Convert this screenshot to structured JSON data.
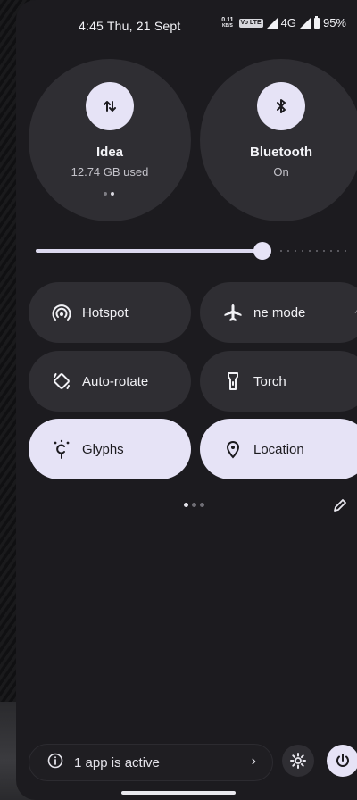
{
  "status_bar": {
    "time_date": "4:45  Thu, 21 Sept",
    "net_speed_value": "0.11",
    "net_speed_unit": "KB/S",
    "volte": "Vo LTE",
    "network": "4G",
    "battery": "95%"
  },
  "large_tiles": [
    {
      "title": "Idea",
      "subtitle": "12.74 GB used",
      "icon": "mobile-data-icon"
    },
    {
      "title": "Bluetooth",
      "subtitle": "On",
      "icon": "bluetooth-icon"
    }
  ],
  "brightness": {
    "level": 0.68
  },
  "tiles": [
    {
      "label": "Hotspot",
      "icon": "hotspot-icon",
      "active": false
    },
    {
      "label": "ne mode",
      "icon": "airplane-icon",
      "active": false
    },
    {
      "label": "Auto-rotate",
      "icon": "auto-rotate-icon",
      "active": false
    },
    {
      "label": "Torch",
      "icon": "torch-icon",
      "active": false
    },
    {
      "label": "Glyphs",
      "icon": "glyphs-icon",
      "active": true
    },
    {
      "label": "Location",
      "icon": "location-icon",
      "active": true
    }
  ],
  "footer": {
    "active_apps": "1 app is active",
    "chevron": "›"
  },
  "colors": {
    "active_tile": "#e6e3f6",
    "inactive_tile": "#2f2e33",
    "shade_bg": "#1c1b1f"
  }
}
